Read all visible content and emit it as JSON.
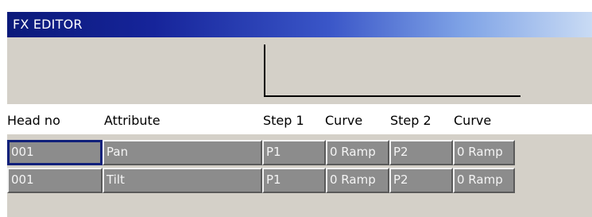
{
  "window": {
    "title": "FX EDITOR"
  },
  "table": {
    "headers": {
      "head_no": "Head no",
      "attribute": "Attribute",
      "step1": "Step 1",
      "curve1": "Curve",
      "step2": "Step 2",
      "curve2": "Curve"
    },
    "rows": [
      {
        "head_no": "001",
        "attribute": "Pan",
        "step1": "P1",
        "curve1": "0 Ramp",
        "step2": "P2",
        "curve2": "0 Ramp"
      },
      {
        "head_no": "001",
        "attribute": "Tilt",
        "step1": "P1",
        "curve1": "0 Ramp",
        "step2": "P2",
        "curve2": "0 Ramp"
      }
    ]
  },
  "colors": {
    "title_bar_start": "#0b1a7a",
    "title_bar_end": "#c9dbf4",
    "panel_gray": "#d4d0c8",
    "cell_gray": "#8c8c8c",
    "selection_border": "#10207a"
  }
}
